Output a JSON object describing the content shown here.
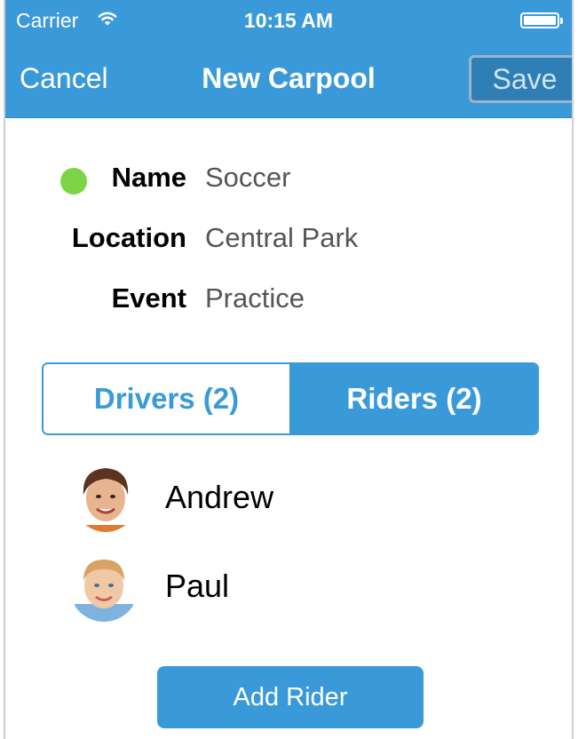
{
  "status_bar": {
    "carrier": "Carrier",
    "time": "10:15 AM"
  },
  "nav": {
    "cancel_label": "Cancel",
    "title": "New Carpool",
    "save_label": "Save"
  },
  "form": {
    "name_label": "Name",
    "name_value": "Soccer",
    "location_label": "Location",
    "location_value": "Central Park",
    "event_label": "Event",
    "event_value": "Practice",
    "status_dot_color": "#7dd447"
  },
  "segments": [
    {
      "label": "Drivers (2)",
      "selected": false
    },
    {
      "label": "Riders (2)",
      "selected": true
    }
  ],
  "riders": [
    {
      "name": "Andrew"
    },
    {
      "name": "Paul"
    }
  ],
  "add_button_label": "Add Rider",
  "colors": {
    "accent": "#3a9ad9"
  }
}
